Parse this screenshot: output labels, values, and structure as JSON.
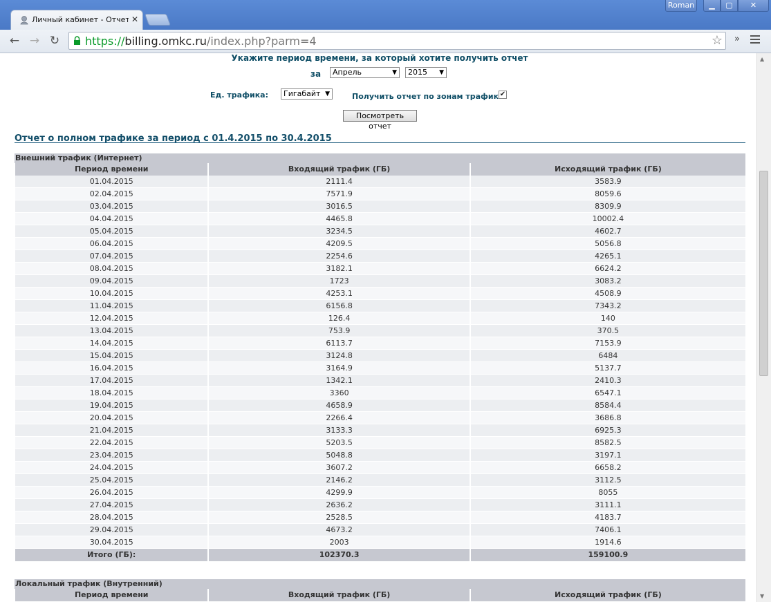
{
  "browser": {
    "tab_title": "Личный кабинет - Отчет о",
    "tab_close": "✕",
    "user": "Roman",
    "url_scheme": "https://",
    "url_host": "billing.omkc.ru",
    "url_path": "/index.php?parm=4"
  },
  "form": {
    "title": "Укажите период времени, за который хотите получить отчет",
    "for_label": "за",
    "month": "Апрель",
    "year": "2015",
    "unit_label": "Ед. трафика:",
    "unit": "Гигабайт",
    "zones_label": "Получить отчет по зонам трафика:",
    "zones_checked": true,
    "submit": "Посмотреть отчет"
  },
  "report": {
    "title": "Отчет о полном трафике за период с 01.4.2015 по 30.4.2015",
    "external": {
      "section_title": "Внешний трафик (Интернет)",
      "columns": [
        "Период времени",
        "Входящий трафик (ГБ)",
        "Исходящий трафик (ГБ)"
      ],
      "rows": [
        [
          "01.04.2015",
          "2111.4",
          "3583.9"
        ],
        [
          "02.04.2015",
          "7571.9",
          "8059.6"
        ],
        [
          "03.04.2015",
          "3016.5",
          "8309.9"
        ],
        [
          "04.04.2015",
          "4465.8",
          "10002.4"
        ],
        [
          "05.04.2015",
          "3234.5",
          "4602.7"
        ],
        [
          "06.04.2015",
          "4209.5",
          "5056.8"
        ],
        [
          "07.04.2015",
          "2254.6",
          "4265.1"
        ],
        [
          "08.04.2015",
          "3182.1",
          "6624.2"
        ],
        [
          "09.04.2015",
          "1723",
          "3083.2"
        ],
        [
          "10.04.2015",
          "4253.1",
          "4508.9"
        ],
        [
          "11.04.2015",
          "6156.8",
          "7343.2"
        ],
        [
          "12.04.2015",
          "126.4",
          "140"
        ],
        [
          "13.04.2015",
          "753.9",
          "370.5"
        ],
        [
          "14.04.2015",
          "6113.7",
          "7153.9"
        ],
        [
          "15.04.2015",
          "3124.8",
          "6484"
        ],
        [
          "16.04.2015",
          "3164.9",
          "5137.7"
        ],
        [
          "17.04.2015",
          "1342.1",
          "2410.3"
        ],
        [
          "18.04.2015",
          "3360",
          "6547.1"
        ],
        [
          "19.04.2015",
          "4658.9",
          "8584.4"
        ],
        [
          "20.04.2015",
          "2266.4",
          "3686.8"
        ],
        [
          "21.04.2015",
          "3133.3",
          "6925.3"
        ],
        [
          "22.04.2015",
          "5203.5",
          "8582.5"
        ],
        [
          "23.04.2015",
          "5048.8",
          "3197.1"
        ],
        [
          "24.04.2015",
          "3607.2",
          "6658.2"
        ],
        [
          "25.04.2015",
          "2146.2",
          "3112.5"
        ],
        [
          "26.04.2015",
          "4299.9",
          "8055"
        ],
        [
          "27.04.2015",
          "2636.2",
          "3111.1"
        ],
        [
          "28.04.2015",
          "2528.5",
          "4183.7"
        ],
        [
          "29.04.2015",
          "4673.2",
          "7406.1"
        ],
        [
          "30.04.2015",
          "2003",
          "1914.6"
        ]
      ],
      "total": [
        "Итого (ГБ):",
        "102370.3",
        "159100.9"
      ]
    },
    "local": {
      "section_title": "Локальный трафик (Внутренний)",
      "columns": [
        "Период времени",
        "Входящий трафик (ГБ)",
        "Исходящий трафик (ГБ)"
      ]
    }
  }
}
